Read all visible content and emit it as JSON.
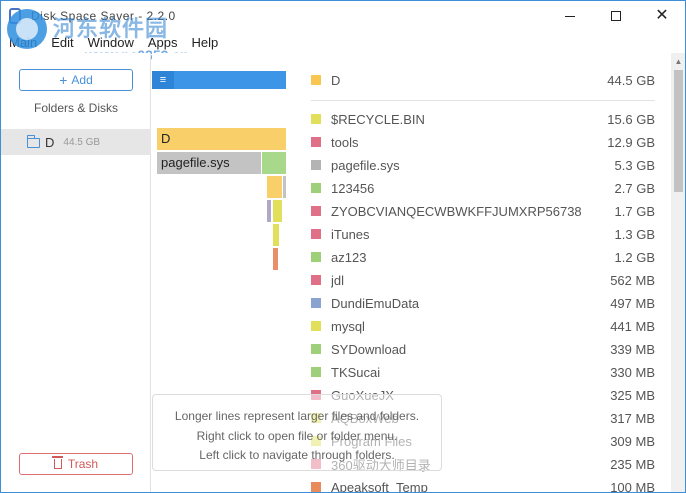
{
  "titlebar": {
    "title": "Disk Space Saver - 2.2.0"
  },
  "watermark": {
    "site_name": "河东软件园",
    "url": "www.pc0359.cn"
  },
  "menu": [
    "Main",
    "Edit",
    "Window",
    "Apps",
    "Help"
  ],
  "sidebar": {
    "add_label": "Add",
    "heading": "Folders & Disks",
    "disk": {
      "name": "D",
      "size": "44.5 GB"
    },
    "trash_label": "Trash"
  },
  "viz": {
    "menu_glyph": "≡",
    "root_label": "D",
    "pagefile_label": "pagefile.sys"
  },
  "hint": {
    "line1": "Longer lines represent larger files and folders.",
    "line2": "Right click to open file or folder menu.",
    "line3": "Left click to navigate through folders."
  },
  "list": {
    "root": {
      "name": "D",
      "size": "44.5 GB",
      "color": "#f9c74f"
    },
    "items": [
      {
        "name": "$RECYCLE.BIN",
        "size": "15.6 GB",
        "color": "#e2e05a"
      },
      {
        "name": "tools",
        "size": "12.9 GB",
        "color": "#df7088"
      },
      {
        "name": "pagefile.sys",
        "size": "5.3 GB",
        "color": "#b4b4b4"
      },
      {
        "name": "123456",
        "size": "2.7 GB",
        "color": "#9ed07a"
      },
      {
        "name": "ZYOBCVIANQECWBWKFFJUMXRP56738",
        "size": "1.7 GB",
        "color": "#df7088"
      },
      {
        "name": "iTunes",
        "size": "1.3 GB",
        "color": "#df7088"
      },
      {
        "name": "az123",
        "size": "1.2 GB",
        "color": "#9ed07a"
      },
      {
        "name": "jdl",
        "size": "562 MB",
        "color": "#df7088"
      },
      {
        "name": "DundiEmuData",
        "size": "497 MB",
        "color": "#8aa3cf"
      },
      {
        "name": "mysql",
        "size": "441 MB",
        "color": "#e2e05a"
      },
      {
        "name": "SYDownload",
        "size": "339 MB",
        "color": "#9ed07a"
      },
      {
        "name": "TKSucai",
        "size": "330 MB",
        "color": "#9ed07a"
      },
      {
        "name": "GuoXueJX",
        "size": "325 MB",
        "color": "#df7088"
      },
      {
        "name": "AQBoxWeb",
        "size": "317 MB",
        "color": "#e2e05a"
      },
      {
        "name": "Program Files",
        "size": "309 MB",
        "color": "#e2e05a"
      },
      {
        "name": "360驱动大师目录",
        "size": "235 MB",
        "color": "#df7088"
      },
      {
        "name": "Apeaksoft_Temp",
        "size": "100 MB",
        "color": "#e88a5a"
      }
    ]
  }
}
